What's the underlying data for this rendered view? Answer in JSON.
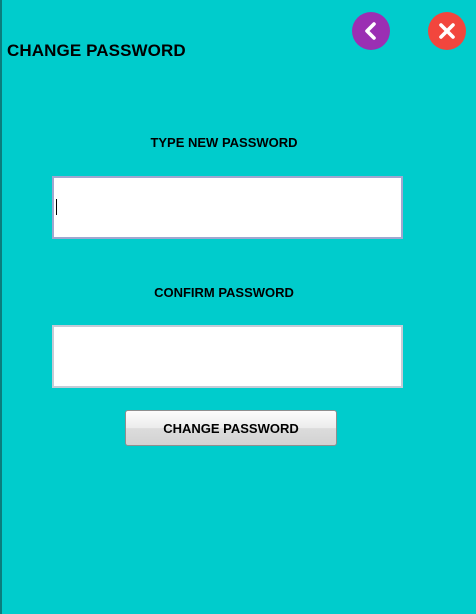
{
  "header": {
    "title": "CHANGE PASSWORD",
    "back_icon": "chevron-left-icon",
    "close_icon": "close-icon"
  },
  "form": {
    "new_password": {
      "label": "TYPE NEW PASSWORD",
      "value": "",
      "placeholder": ""
    },
    "confirm_password": {
      "label": "CONFIRM PASSWORD",
      "value": "",
      "placeholder": ""
    },
    "submit_label": "CHANGE PASSWORD"
  },
  "colors": {
    "background": "#00cccc",
    "back_button": "#9b2fb3",
    "close_button": "#f2463d"
  }
}
